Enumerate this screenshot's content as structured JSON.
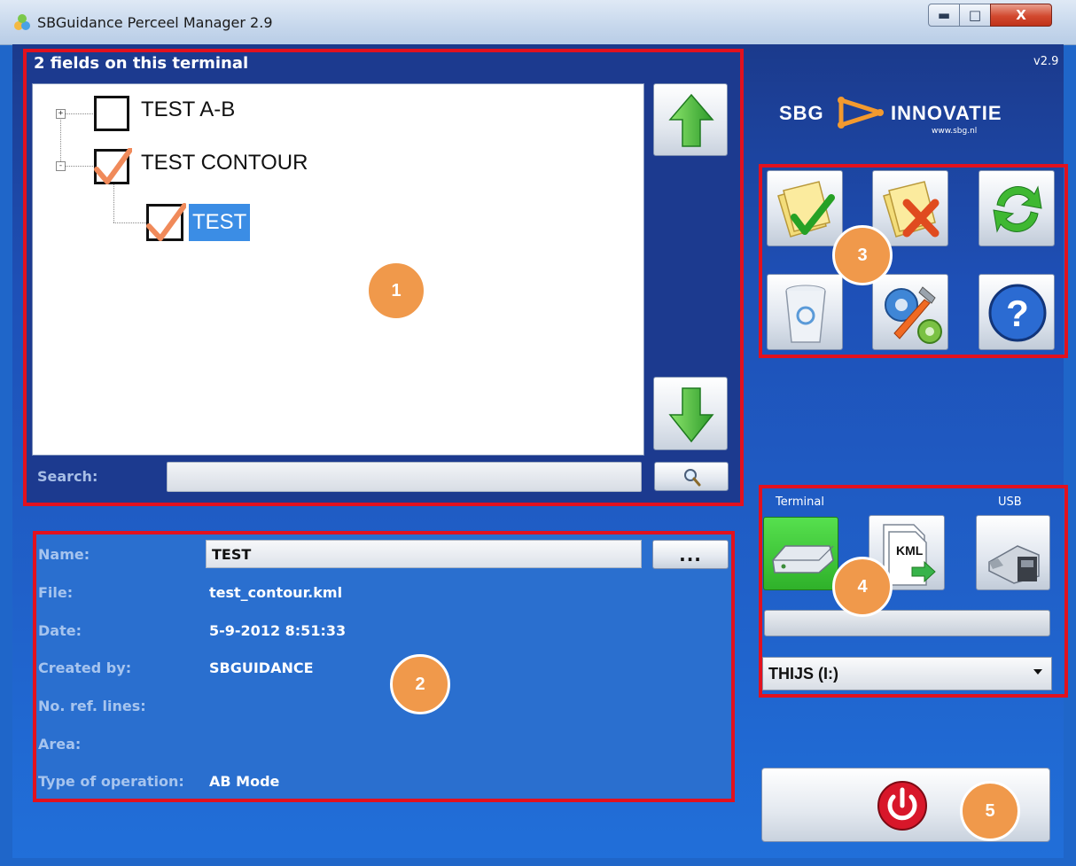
{
  "window": {
    "title": "SBGuidance Perceel Manager 2.9",
    "close_glyph": "X"
  },
  "fields_panel": {
    "title": "2 fields on this terminal",
    "tree": [
      {
        "label": "TEST A-B",
        "checked": false,
        "expander": "+"
      },
      {
        "label": "TEST CONTOUR",
        "checked": true,
        "expander": "-"
      },
      {
        "label": "TEST",
        "checked": true,
        "selected": true
      }
    ],
    "search_label": "Search:",
    "search_value": ""
  },
  "details": {
    "labels": {
      "name": "Name:",
      "file": "File:",
      "date": "Date:",
      "created_by": "Created by:",
      "ref_lines": "No. ref. lines:",
      "area": "Area:",
      "operation": "Type of operation:"
    },
    "values": {
      "name": "TEST",
      "file": "test_contour.kml",
      "date": "5-9-2012 8:51:33",
      "created_by": "SBGUIDANCE",
      "ref_lines": "",
      "area": "",
      "operation": "AB Mode"
    },
    "browse_label": "..."
  },
  "header": {
    "version": "v2.9",
    "logo_left": "SBG",
    "logo_right": "INNOVATIE",
    "logo_url": "www.sbg.nl"
  },
  "transfer": {
    "terminal_label": "Terminal",
    "usb_label": "USB",
    "kml_label": "KML",
    "drive_value": "THIJS (I:)"
  },
  "badges": [
    "1",
    "2",
    "3",
    "4",
    "5"
  ],
  "colors": {
    "highlight_red": "#e2111e",
    "badge_orange": "#f0994b",
    "selection_blue": "#3b8de5",
    "terminal_active_green": "#3fcf3a"
  }
}
